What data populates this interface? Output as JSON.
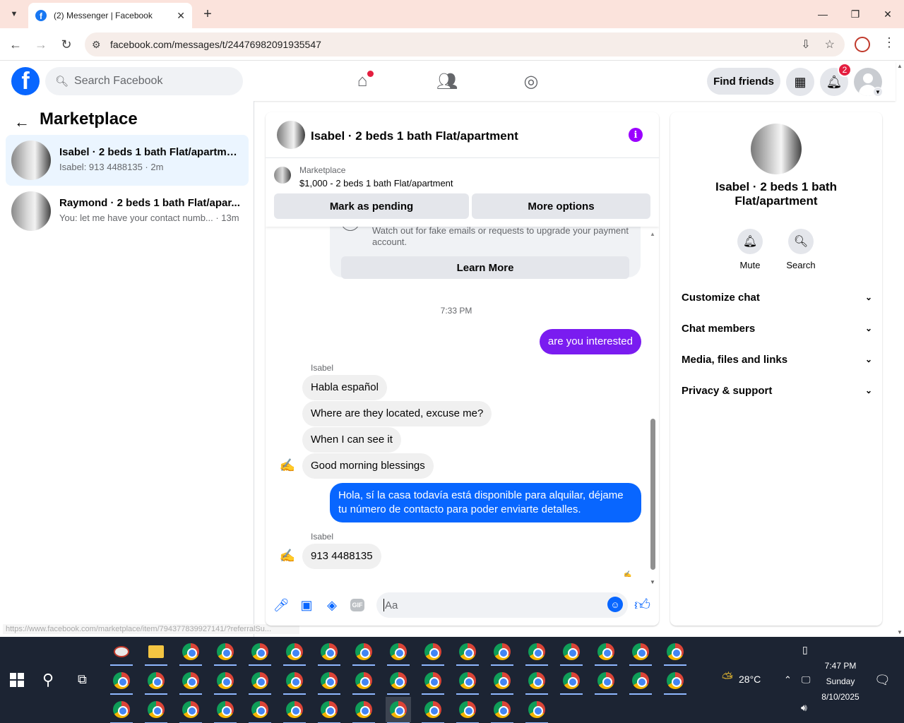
{
  "browser": {
    "tab_title": "(2) Messenger | Facebook",
    "url": "facebook.com/messages/t/24476982091935547",
    "status_url": "https://www.facebook.com/marketplace/item/794377839927141/?referralSu..."
  },
  "fb_header": {
    "search_placeholder": "Search Facebook",
    "find_friends_label": "Find friends",
    "notification_count": "2"
  },
  "left": {
    "title": "Marketplace",
    "conversations": [
      {
        "name": "Isabel · 2 beds 1 bath Flat/apartment",
        "preview": "Isabel: 913 4488135 · 2m",
        "selected": true
      },
      {
        "name": "Raymond · 2 beds 1 bath Flat/apar...",
        "preview": "You: let me have your contact numb... · 13m",
        "selected": false
      }
    ]
  },
  "chat": {
    "title": "Isabel · 2 beds 1 bath Flat/apartment",
    "listing_source": "Marketplace",
    "listing_price_title": "$1,000 - 2 beds 1 bath Flat/apartment",
    "mark_pending_label": "Mark as pending",
    "more_options_label": "More options",
    "safety_text": "Watch out for fake emails or requests to upgrade your payment account.",
    "learn_more_label": "Learn More",
    "timestamp": "7:33 PM",
    "messages": [
      {
        "from": "me",
        "text": "are you interested"
      },
      {
        "from": "Isabel",
        "text": "Habla español"
      },
      {
        "from": "Isabel",
        "text": "Where are they located, excuse me?"
      },
      {
        "from": "Isabel",
        "text": "When I can see it"
      },
      {
        "from": "Isabel",
        "text": "Good morning blessings"
      },
      {
        "from": "me",
        "text": "Hola, sí la casa todavía está disponible para alquilar, déjame tu número de contacto para poder enviarte detalles."
      },
      {
        "from": "Isabel",
        "text": "913 4488135"
      }
    ],
    "sender_name": "Isabel",
    "input_placeholder": "Aa",
    "gif_label": "GIF"
  },
  "right": {
    "title": "Isabel · 2 beds 1 bath Flat/apartment",
    "actions": [
      {
        "label": "Mute",
        "icon": "bell-icon"
      },
      {
        "label": "Search",
        "icon": "search-icon"
      }
    ],
    "sections": [
      "Customize chat",
      "Chat members",
      "Media, files and links",
      "Privacy & support"
    ]
  },
  "taskbar": {
    "temperature": "28°C",
    "time": "7:47 PM",
    "day": "Sunday",
    "date": "8/10/2025"
  },
  "colors": {
    "fb_blue": "#0866ff",
    "outgoing_purple": "#7a1cf0",
    "outgoing_blue": "#0866ff",
    "selected_conv": "#ebf5ff"
  }
}
